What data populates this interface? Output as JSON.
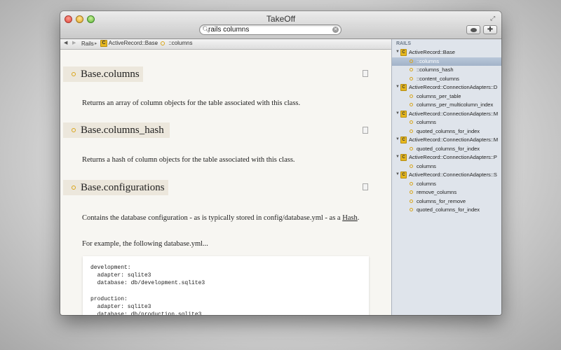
{
  "window": {
    "title": "TakeOff"
  },
  "search": {
    "value": "rails columns"
  },
  "breadcrumb": {
    "items": [
      "Rails",
      "ActiveRecord::Base",
      "::columns"
    ]
  },
  "methods": [
    {
      "name": "Base.columns",
      "description": "Returns an array of column objects for the table associated with this class."
    },
    {
      "name": "Base.columns_hash",
      "description": "Returns a hash of column objects for the table associated with this class."
    },
    {
      "name": "Base.configurations",
      "description_line1": "Contains the database configuration - as is typically stored in config/database.yml - as a",
      "description_link": "Hash",
      "description_end": ".",
      "example_intro": "For example, the following database.yml..."
    }
  ],
  "code": "development:\n  adapter: sqlite3\n  database: db/development.sqlite3\n\nproduction:\n  adapter: sqlite3\n  database: db/production.sqlite3",
  "sidebar": {
    "header": "RAILS",
    "groups": [
      {
        "class": "ActiveRecord::Base",
        "methods": [
          "::columns",
          "::columns_hash",
          "::content_columns"
        ]
      },
      {
        "class": "ActiveRecord::ConnectionAdapters::D",
        "methods": [
          "columns_per_table",
          "columns_per_multicolumn_index"
        ]
      },
      {
        "class": "ActiveRecord::ConnectionAdapters::M",
        "methods": [
          "columns",
          "quoted_columns_for_index"
        ]
      },
      {
        "class": "ActiveRecord::ConnectionAdapters::M",
        "methods": [
          "quoted_columns_for_index"
        ]
      },
      {
        "class": "ActiveRecord::ConnectionAdapters::P",
        "methods": [
          "columns"
        ]
      },
      {
        "class": "ActiveRecord::ConnectionAdapters::S",
        "methods": [
          "columns",
          "remove_columns",
          "columns_for_remove",
          "quoted_columns_for_index"
        ]
      }
    ]
  },
  "colors": {
    "accent": "#e8b91f",
    "selection": "#a2b3c9"
  },
  "icons": {
    "class_badge": "C"
  }
}
